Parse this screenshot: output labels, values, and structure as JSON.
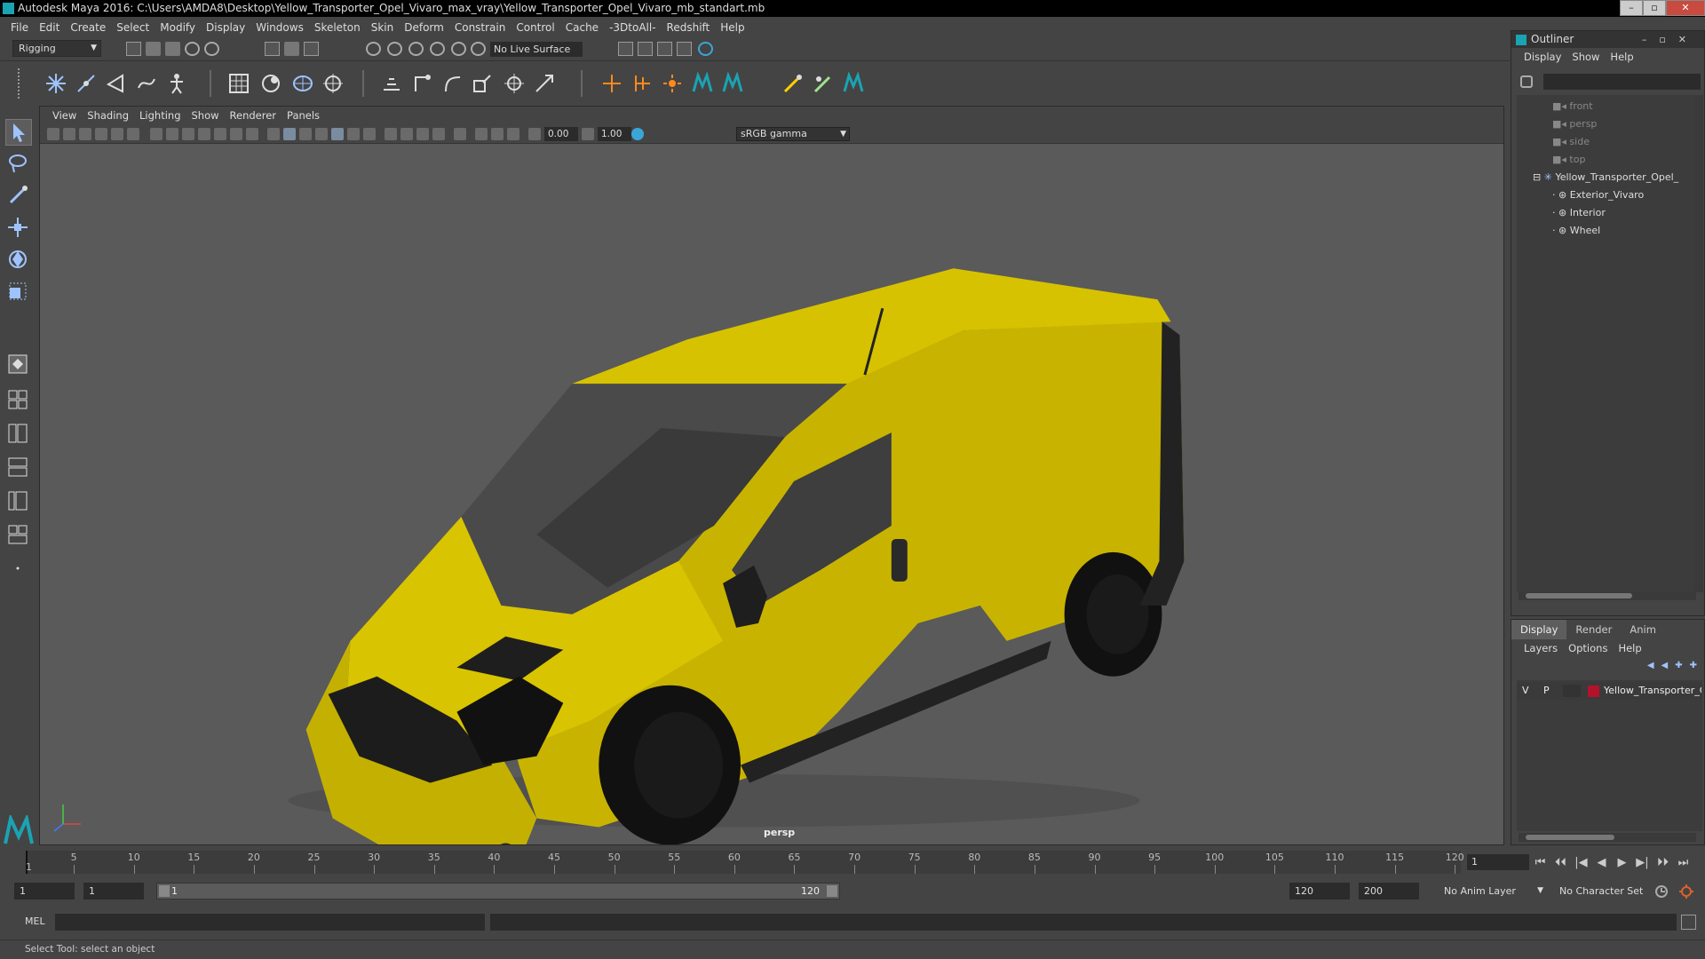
{
  "window": {
    "title": "Autodesk Maya 2016: C:\\Users\\AMDA8\\Desktop\\Yellow_Transporter_Opel_Vivaro_max_vray\\Yellow_Transporter_Opel_Vivaro_mb_standart.mb",
    "minimize": "–",
    "maximize": "▫",
    "close": "✕"
  },
  "menubar": [
    "File",
    "Edit",
    "Create",
    "Select",
    "Modify",
    "Display",
    "Windows",
    "Skeleton",
    "Skin",
    "Deform",
    "Constrain",
    "Control",
    "Cache",
    "-3DtoAll-",
    "Redshift",
    "Help"
  ],
  "statusline": {
    "mode": "Rigging",
    "live_surface": "No Live Surface"
  },
  "viewport": {
    "menus": [
      "View",
      "Shading",
      "Lighting",
      "Show",
      "Renderer",
      "Panels"
    ],
    "exposure": "0.00",
    "gamma": "1.00",
    "color_space": "sRGB gamma",
    "camera": "persp",
    "model_color": "#c8b400"
  },
  "outliner": {
    "title": "Outliner",
    "menus": [
      "Display",
      "Show",
      "Help"
    ],
    "items": [
      {
        "label": "front",
        "type": "camera",
        "depth": 0
      },
      {
        "label": "persp",
        "type": "camera",
        "depth": 0
      },
      {
        "label": "side",
        "type": "camera",
        "depth": 0
      },
      {
        "label": "top",
        "type": "camera",
        "depth": 0
      },
      {
        "label": "Yellow_Transporter_Opel_",
        "type": "group",
        "depth": 0
      },
      {
        "label": "Exterior_Vivaro",
        "type": "mesh",
        "depth": 1
      },
      {
        "label": "Interior",
        "type": "mesh",
        "depth": 1
      },
      {
        "label": "Wheel",
        "type": "mesh",
        "depth": 1
      }
    ]
  },
  "layers": {
    "tabs": [
      "Display",
      "Render",
      "Anim"
    ],
    "active_tab": "Display",
    "menus": [
      "Layers",
      "Options",
      "Help"
    ],
    "rows": [
      {
        "v": "V",
        "p": "P",
        "name": "Yellow_Transporter_Op",
        "color": "#b3122d"
      }
    ]
  },
  "timeline": {
    "ticks": [
      "5",
      "10",
      "15",
      "20",
      "25",
      "30",
      "35",
      "40",
      "45",
      "50",
      "55",
      "60",
      "65",
      "70",
      "75",
      "80",
      "85",
      "90",
      "95",
      "100",
      "105",
      "110",
      "115",
      "120"
    ],
    "first_tick": "1",
    "current_frame": "1",
    "playback_buttons": [
      "⏮",
      "⏴⏴",
      "|◀",
      "◀",
      "▶",
      "▶|",
      "⏵⏵",
      "⏭"
    ]
  },
  "range": {
    "start_field": "1",
    "start_inner": "1",
    "slider_start": "1",
    "slider_end": "120",
    "end_field": "120",
    "max_field": "200",
    "anim_layer": "No Anim Layer",
    "character_set": "No Character Set"
  },
  "commandline": {
    "label": "MEL"
  },
  "helpline": {
    "text": "Select Tool: select an object"
  }
}
